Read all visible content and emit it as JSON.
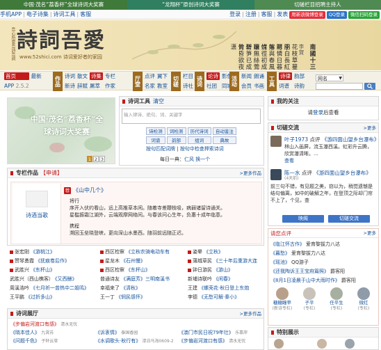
{
  "promo": [
    "中国·茂名“荔香杯”全球诗词大奖赛",
    "“龙翔杯”原创诗词大奖赛",
    "切磋栏目招聘主持人"
  ],
  "utilbar": {
    "left": [
      "手机APP",
      "电子诗集",
      "诗词工具",
      "客服"
    ],
    "right": [
      "登录",
      "注册",
      "客服",
      "发表"
    ],
    "share": {
      "sina": "用新浪微博登录",
      "qq": "QQ登录",
      "wx": "微信扫码登录"
    }
  },
  "header": {
    "logo_text": "詩詞吾愛",
    "logo_vertical": "吾心所愛吾詩吾詞",
    "url_text": "www.52shici.com 诗词爱好者的家园",
    "poem": {
      "title": "南國十三首",
      "author": "李賀",
      "columns": [
        "花枝草蔓眼中開",
        "小白長紅越女腮",
        "可憐日暮嫣香落",
        "嫁與春風不用媒",
        "竹徑初成碧玉環",
        "雖無絲鶯天外碧",
        "新笋已成堂下竹",
        "黃昏欲夜雨潇潇"
      ]
    }
  },
  "nav": {
    "home": "首页",
    "home_sub": [
      "最新",
      "APP"
    ],
    "home_badge": "2.5.2",
    "groups": [
      {
        "big": "作品",
        "links": [
          "诗词",
          "新诗",
          "散文",
          "辞赋",
          "诗集",
          "屠萃",
          "专栏",
          "作家"
        ],
        "tag": "诗集"
      },
      {
        "big": "厅堂",
        "links": [
          "点评",
          "名家",
          "翼下",
          "教室"
        ]
      },
      {
        "big": "切磋",
        "links": [
          "栏目",
          "诗社"
        ]
      },
      {
        "big": "诗词",
        "links": [
          "论诗",
          "社团",
          "影像",
          "同城"
        ],
        "tag": "论诗"
      },
      {
        "big": "活动",
        "links": [
          "新闻",
          "会员",
          "朗诵",
          "书画"
        ]
      },
      {
        "big": "文",
        "links": [
          "诗词",
          "诗友",
          "词话",
          "编辑",
          "繁简"
        ],
        "tag": "诗词"
      },
      {
        "big": "工具",
        "links": [
          "诗律",
          "词谱",
          "韵部",
          "诗韵",
          "平水",
          "词林"
        ],
        "tag": "诗律"
      }
    ],
    "search_select": "网名"
  },
  "slide": {
    "text": "中国·茂名“荔香杯”全球诗词大奖赛",
    "pages": [
      "1",
      "2",
      "3"
    ]
  },
  "tools": {
    "title": "诗词工具",
    "clear": "清空",
    "placeholder": "输入律诗、绝句、词、关键字",
    "buttons": [
      "诗检测",
      "词检测",
      "历代诗词",
      "自动鉴注",
      "词谱",
      "韵部",
      "组词",
      "典故",
      "繁简",
      "对联"
    ],
    "links": [
      "按句匹配词牌",
      "按句中检查押索诗词"
    ],
    "daily_label": "每日一典：",
    "daily_item": "仁风",
    "daily_more": "换一个"
  },
  "follow": {
    "title": "我的关注",
    "text_prefix": "请",
    "login": "登录",
    "text_suffix": "后查看"
  },
  "exchange": {
    "title": "切磋交流",
    "more": ">更多",
    "items": [
      {
        "user": "叶子1973",
        "action": "点评",
        "work": "《游四面山望乡台瀑布》",
        "text": "林山入画屏，流玉瀑西溪。虹彩升云腾，欣赏瀑清晰。...",
        "more": "查看"
      },
      {
        "user": "陈一水",
        "action": "点评",
        "work": "《游四面山望乡台瀑布》",
        "sub": "(4天前)",
        "text": "前三句不错，有见题之美，窃以为，稍觉遗憾是结句偏离，如中的破解之年，在登顶之际却门帘不上了，个见，查",
        "more": "查看"
      }
    ],
    "buttons": [
      "映阁",
      "切磋交流"
    ]
  },
  "featured": {
    "title": "专栏作品",
    "apply": "【申请】",
    "more": ">更多作品",
    "author": "诗酒当歌",
    "badge": "荐",
    "work_title": "《山中几个》",
    "lines": [
      "将行",
      "序开入伏约看山，远上高推草本闲。随着寺差鞭枝吸，病弱诸留诗通关。",
      "星槛振霜江湖外，云端观摩网络间。与春该问心生年，负惠十成年临意。",
      "",
      "携程",
      "溯回玉垒晓登峡，更向深山水墨西。随羽前远随正迟。"
    ]
  },
  "recent": [
    [
      {
        "u": "张宏刚",
        "w": "《游桃江》"
      },
      {
        "u": "西区检察",
        "w": "《立秋农骑电动车有"
      },
      {
        "u": "姿晕",
        "w": "《立秋》"
      }
    ],
    [
      {
        "u": "赞琴勇霞",
        "w": "《抚痕卷后作》"
      },
      {
        "u": "星龙木",
        "w": "《石州慢》"
      },
      {
        "u": "蒲城草民",
        "w": "《三十年后重游大连"
      }
    ],
    [
      {
        "u": "武胜兴",
        "w": "《东杯山》"
      },
      {
        "u": "西区检察",
        "w": "《东杯山》"
      },
      {
        "u": "钟日游民",
        "w": "《游山》"
      }
    ],
    [
      {
        "u": "武胜兴（西山樵客）",
        "w": "《又西酬》"
      },
      {
        "u": "普通诗友",
        "w": "《满庭芳》三明南溪书"
      },
      {
        "u": "新埔诗联吟",
        "w": "《闲春》"
      }
    ],
    [
      {
        "u": "周溪浩吟",
        "w": "《七月祈一曾热中二姐鸣》"
      },
      {
        "u": "幸福来了",
        "w": "《清秋》"
      },
      {
        "u": "王建",
        "w": "《螺壳花·秋日登上东炮"
      }
    ],
    [
      {
        "u": "王平鹏",
        "w": "《过折多山》"
      },
      {
        "u": "王一丁",
        "w": "《悯民感怀》"
      },
      {
        "u": "李德",
        "w": "《无愁可解·秦小》"
      }
    ]
  ],
  "hall": {
    "title": "诗词展厅",
    "more": ">更多作品",
    "rows": [
      [
        {
          "t": "《步偏岩河渡口有感》",
          "m": "清水无忧"
        }
      ],
      [
        {
          "t": "《晓本佳人》",
          "m": "九霄苏"
        },
        {
          "t": "《诉衷情》",
          "m": "泰国香园"
        },
        {
          "t": "《澳门市民日祝79年壮》",
          "m": "乐靠岸"
        }
      ],
      [
        {
          "t": "《问题千色》",
          "m": "子轩云草"
        },
        {
          "t": "《水调歌头·秋行有》",
          "m": "漆泊马海0609-2"
        },
        {
          "t": "《步偏岩河渡口有感》",
          "m": "清水无忧"
        }
      ]
    ]
  },
  "reviews": {
    "title": "请您点评",
    "more": ">更多",
    "items": [
      {
        "w": "《临江怀古作》",
        "u": "爱育黎拔力八达"
      },
      {
        "w": "《暮愁》",
        "u": "爱育黎拔力八达"
      },
      {
        "w": "《瑶池》",
        "u": "QQ游子"
      },
      {
        "w": "《还我陶诉王王宝府篇照》",
        "u": "爵客阳"
      },
      {
        "w": "《8月1日凌晨于山中大雨时作》",
        "u": "爵客阳"
      }
    ],
    "people": [
      {
        "n": "糖糖瞳苹",
        "c": "(新诗专栏)"
      },
      {
        "n": "子平",
        "c": "(专栏)"
      },
      {
        "n": "任平生",
        "c": "(专栏)"
      },
      {
        "n": "微红",
        "c": "(专栏)"
      }
    ]
  },
  "special": {
    "title": "特别展示"
  },
  "colors": {
    "accent_red": "#c41a1a",
    "link_blue": "#15529a",
    "nav_brown": "#9c6a1e",
    "header_bg": "#f0e2b4"
  }
}
